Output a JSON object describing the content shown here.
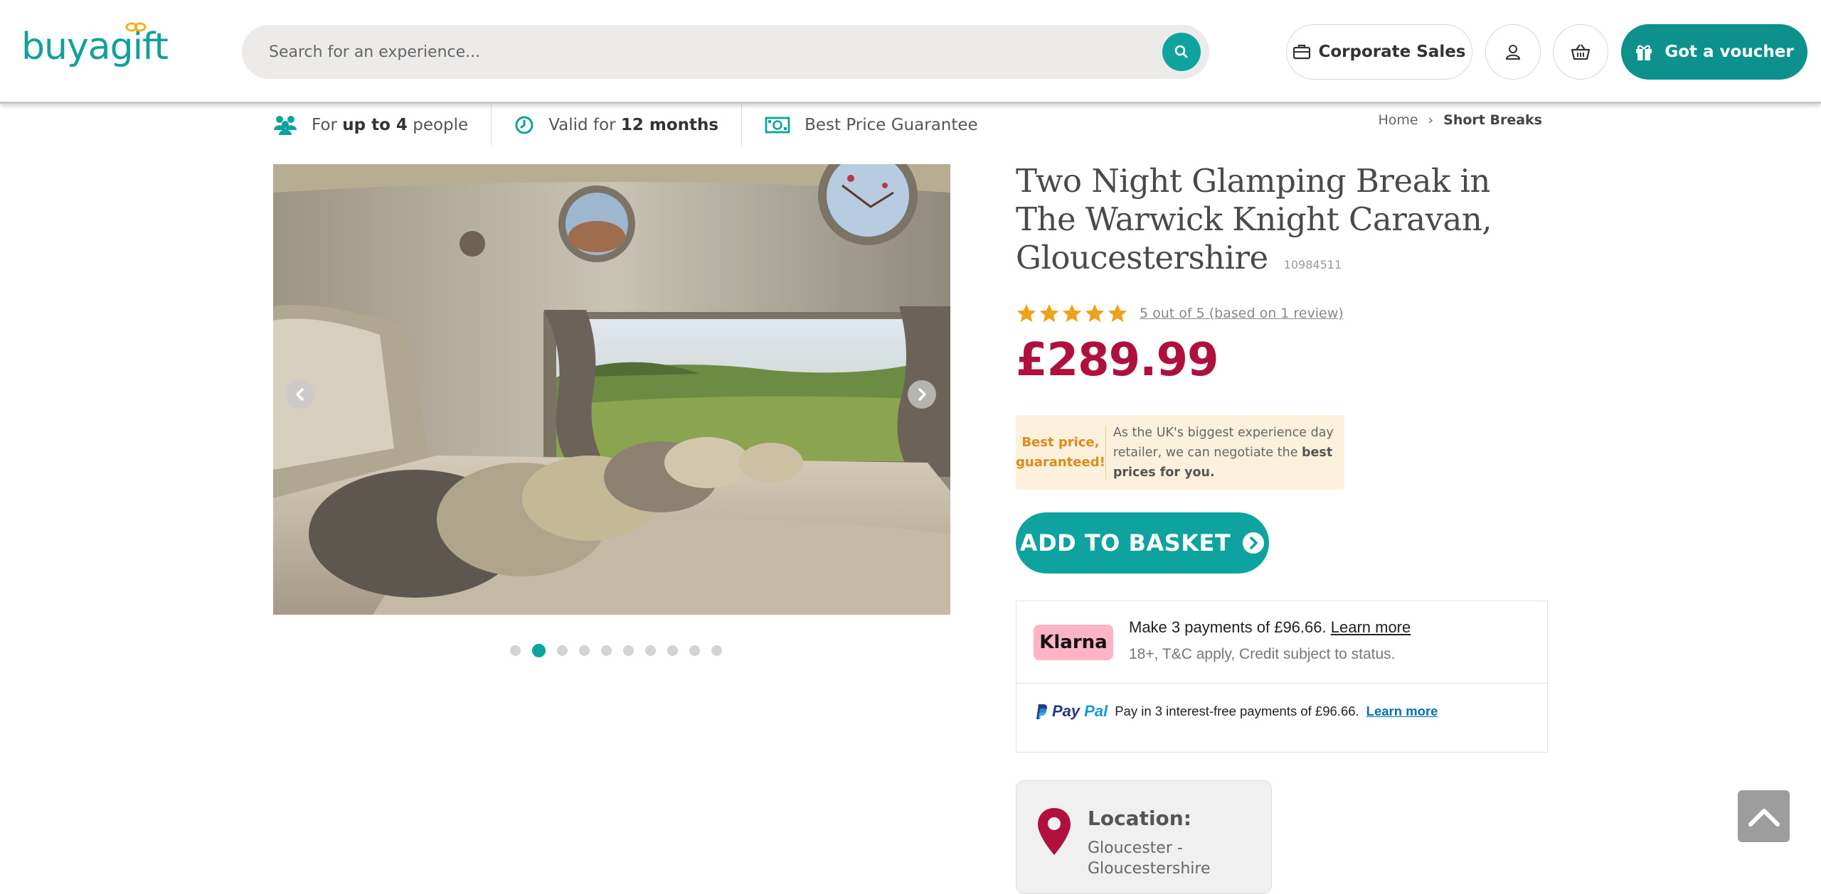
{
  "header": {
    "logo_text": "buyagift",
    "search_placeholder": "Search for an experience...",
    "corporate_label": "Corporate Sales",
    "voucher_label": "Got a voucher",
    "brand_color": "#0fa39f"
  },
  "infobar": {
    "people_prefix": "For ",
    "people_bold": "up to 4",
    "people_suffix": " people",
    "valid_prefix": "Valid for ",
    "valid_bold": "12 months",
    "guarantee": "Best Price Guarantee"
  },
  "breadcrumb": {
    "home": "Home",
    "separator": "›",
    "current": "Short Breaks"
  },
  "gallery": {
    "slide_count": 10,
    "active_index": 1
  },
  "product": {
    "title": "Two Night Glamping Break in The Warwick Knight Caravan, Gloucestershire",
    "sku": "10984511",
    "rating_stars": 5,
    "review_text": "5 out of 5 (based on 1 review)",
    "price": "£289.99",
    "price_color": "#b0103e"
  },
  "best_price": {
    "left_line1": "Best price,",
    "left_line2": "guaranteed!",
    "right_text": "As the UK's biggest experience day retailer, we can negotiate the ",
    "right_bold": "best prices for you."
  },
  "add_to_basket": "ADD TO BASKET",
  "klarna": {
    "badge": "Klarna",
    "line1": "Make 3 payments of £96.66. ",
    "learn_more": "Learn more",
    "line2": "18+, T&C apply, Credit subject to status."
  },
  "paypal": {
    "brand_pay": "Pay",
    "brand_pal": "Pal",
    "text": "Pay in 3 interest-free payments of £96.66.",
    "learn_more": "Learn more"
  },
  "location": {
    "label": "Location:",
    "value": "Gloucester - Gloucestershire"
  }
}
